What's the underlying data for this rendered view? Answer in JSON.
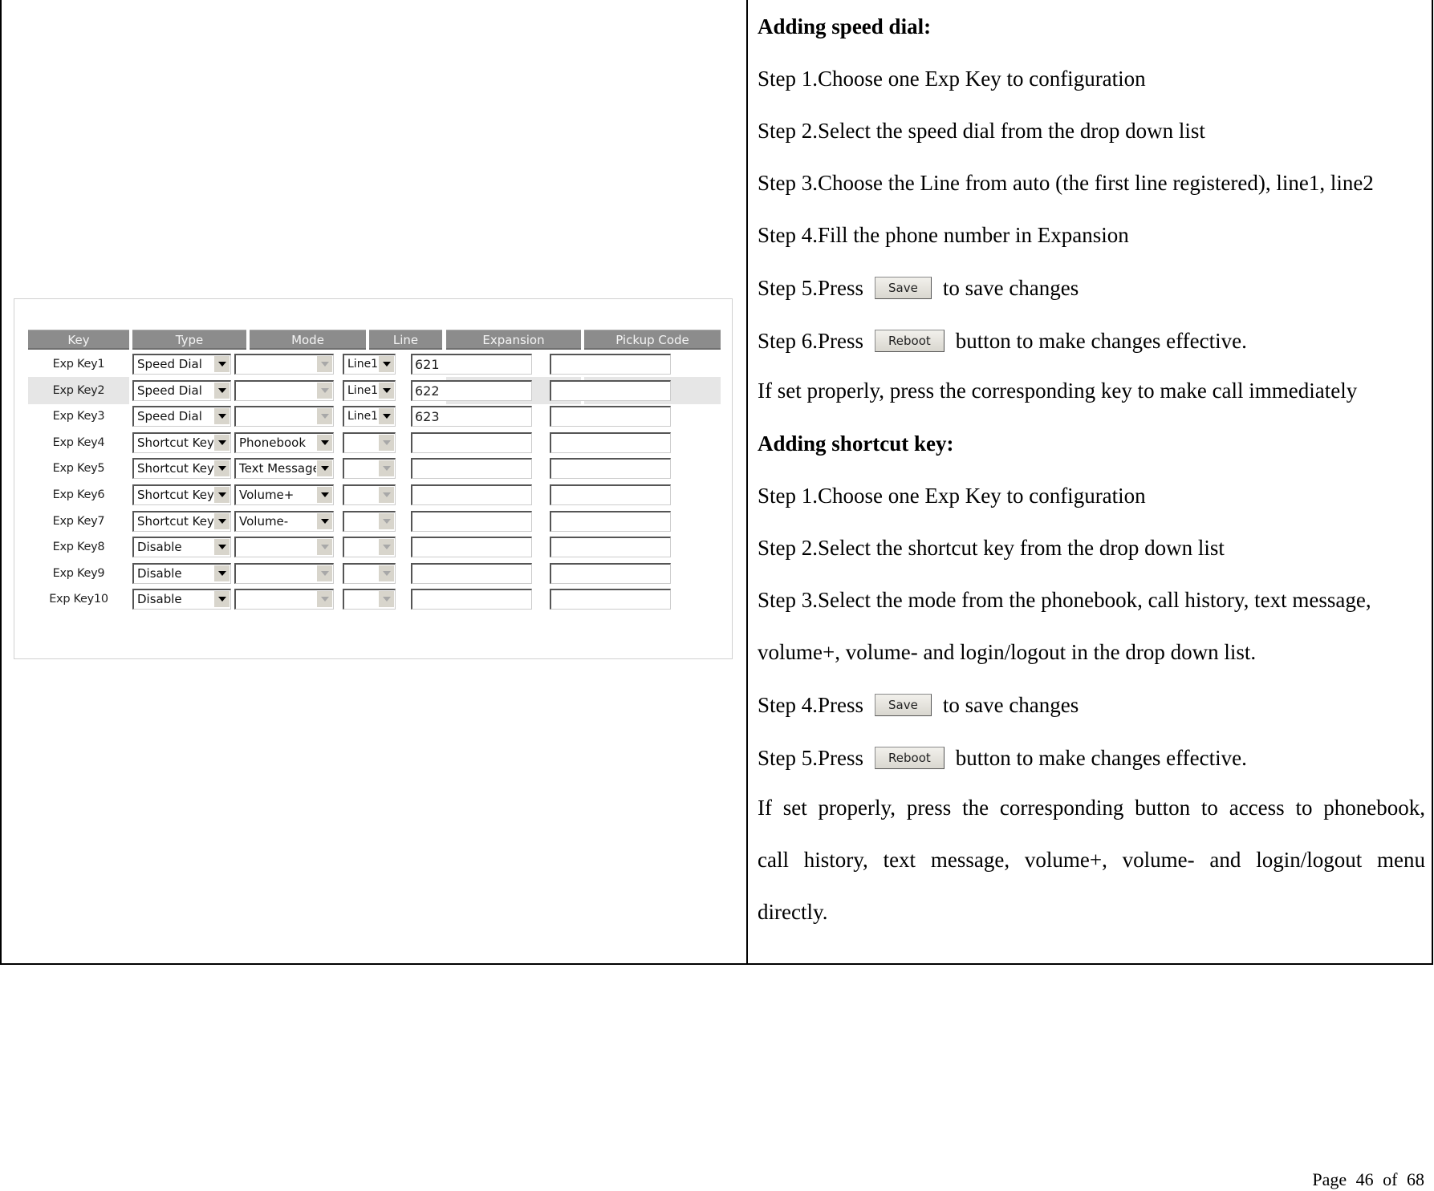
{
  "embedded_screenshot": {
    "columns": [
      "Key",
      "Type",
      "Mode",
      "Line",
      "Expansion",
      "Pickup Code"
    ],
    "rows": [
      {
        "key": "Exp Key1",
        "type": "Speed Dial",
        "mode": "",
        "mode_enabled": false,
        "line": "Line1",
        "line_enabled": true,
        "expansion": "621",
        "pickup_code": ""
      },
      {
        "key": "Exp Key2",
        "type": "Speed Dial",
        "mode": "",
        "mode_enabled": false,
        "line": "Line1",
        "line_enabled": true,
        "expansion": "622",
        "pickup_code": ""
      },
      {
        "key": "Exp Key3",
        "type": "Speed Dial",
        "mode": "",
        "mode_enabled": false,
        "line": "Line1",
        "line_enabled": true,
        "expansion": "623",
        "pickup_code": ""
      },
      {
        "key": "Exp Key4",
        "type": "Shortcut Keys",
        "mode": "Phonebook",
        "mode_enabled": true,
        "line": "",
        "line_enabled": false,
        "expansion": "",
        "pickup_code": ""
      },
      {
        "key": "Exp Key5",
        "type": "Shortcut Keys",
        "mode": "Text Message",
        "mode_enabled": true,
        "line": "",
        "line_enabled": false,
        "expansion": "",
        "pickup_code": ""
      },
      {
        "key": "Exp Key6",
        "type": "Shortcut Keys",
        "mode": "Volume+",
        "mode_enabled": true,
        "line": "",
        "line_enabled": false,
        "expansion": "",
        "pickup_code": ""
      },
      {
        "key": "Exp Key7",
        "type": "Shortcut Keys",
        "mode": "Volume-",
        "mode_enabled": true,
        "line": "",
        "line_enabled": false,
        "expansion": "",
        "pickup_code": ""
      },
      {
        "key": "Exp Key8",
        "type": "Disable",
        "mode": "",
        "mode_enabled": false,
        "line": "",
        "line_enabled": false,
        "expansion": "",
        "pickup_code": ""
      },
      {
        "key": "Exp Key9",
        "type": "Disable",
        "mode": "",
        "mode_enabled": false,
        "line": "",
        "line_enabled": false,
        "expansion": "",
        "pickup_code": ""
      },
      {
        "key": "Exp Key10",
        "type": "Disable",
        "mode": "",
        "mode_enabled": false,
        "line": "",
        "line_enabled": false,
        "expansion": "",
        "pickup_code": ""
      }
    ],
    "highlighted_row": 1
  },
  "instructions": {
    "speed_dial": {
      "heading": "Adding speed dial:",
      "step1": "Step 1.Choose one Exp Key to configuration",
      "step2": "Step 2.Select the speed dial from the drop down list",
      "step3": "Step 3.Choose the Line from auto (the first line registered), line1, line2",
      "step4": "Step 4.Fill the phone number in Expansion",
      "step5_pre": "Step 5.Press",
      "step5_btn": "Save",
      "step5_post": "to save changes",
      "step6_pre": "Step 6.Press",
      "step6_btn": "Reboot",
      "step6_post": "button to make changes effective.",
      "note": "If set properly, press the corresponding key to make call immediately"
    },
    "shortcut_key": {
      "heading": "Adding shortcut key:",
      "step1": "Step 1.Choose one Exp Key to configuration",
      "step2": "Step 2.Select the shortcut key from the drop down list",
      "step3_line1": "Step 3.Select the mode from the phonebook, call history, text message,",
      "step3_line2": "volume+, volume- and login/logout in the drop down list.",
      "step4_pre": "Step 4.Press",
      "step4_btn": "Save",
      "step4_post": "to save changes",
      "step5_pre": "Step 5.Press",
      "step5_btn": "Reboot",
      "step5_post": "button to make changes effective.",
      "note_line1": "If set properly, press the corresponding button to access to phonebook,",
      "note_line2": "call history, text message, volume+, volume- and login/logout menu",
      "note_line3": "directly."
    }
  },
  "footer": {
    "page_label": "Page",
    "page_number": "46",
    "of_label": "of",
    "total_pages": "68"
  }
}
